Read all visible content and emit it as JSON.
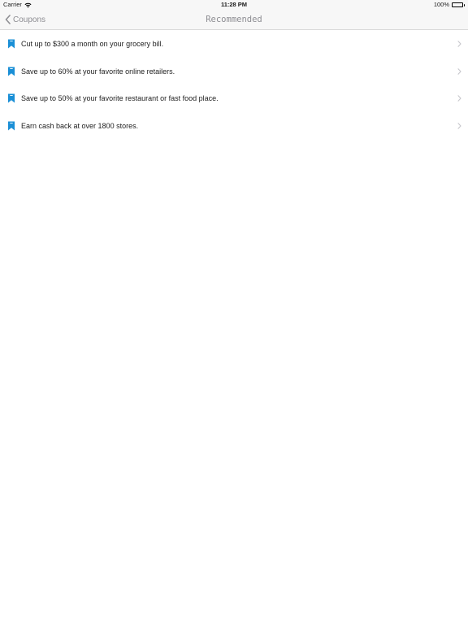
{
  "status_bar": {
    "carrier": "Carrier",
    "time": "11:28 PM",
    "battery": "100%"
  },
  "nav": {
    "back_label": "Coupons",
    "title": "Recommended"
  },
  "list": {
    "items": [
      {
        "label": "Cut up to $300 a month on your grocery bill."
      },
      {
        "label": "Save up to 60% at your favorite online retailers."
      },
      {
        "label": "Save up to 50% at your favorite restaurant or fast food place."
      },
      {
        "label": "Earn cash back at over 1800 stores."
      }
    ]
  },
  "colors": {
    "accent": "#1a8fd6",
    "nav_text": "#8e8e93",
    "chevron": "#c7c7cc"
  }
}
